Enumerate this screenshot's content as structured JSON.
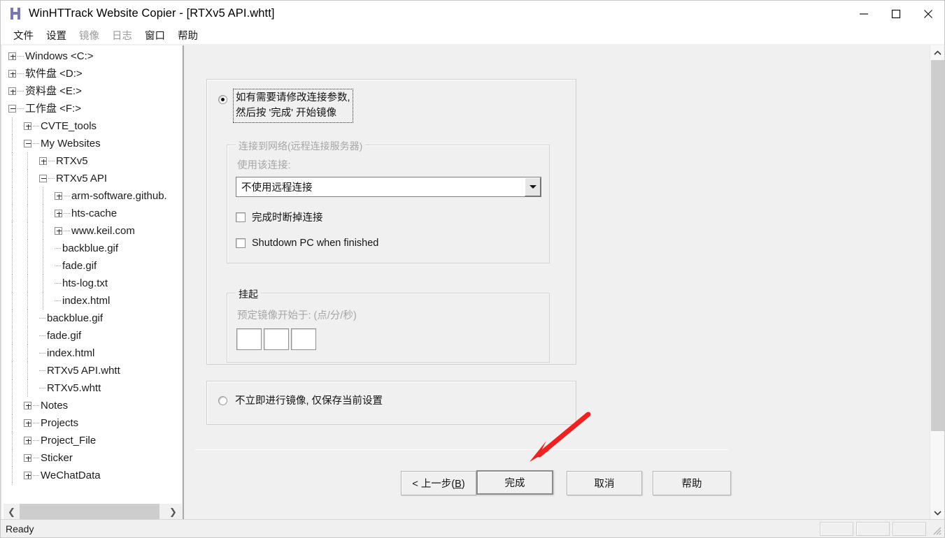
{
  "window": {
    "title": "WinHTTrack Website Copier - [RTXv5 API.whtt]",
    "logo_icon": "winhttrack-h-logo-icon",
    "controls": {
      "minimize": "minimize-icon",
      "maximize": "maximize-icon",
      "close": "close-icon"
    }
  },
  "menubar": {
    "items": [
      {
        "label": "文件",
        "disabled": false
      },
      {
        "label": "设置",
        "disabled": false
      },
      {
        "label": "镜像",
        "disabled": true
      },
      {
        "label": "日志",
        "disabled": true
      },
      {
        "label": "窗口",
        "disabled": false
      },
      {
        "label": "帮助",
        "disabled": false
      }
    ]
  },
  "tree": {
    "nodes": [
      {
        "label": "Windows <C:>",
        "depth": 0,
        "toggle": "plus"
      },
      {
        "label": "软件盘 <D:>",
        "depth": 0,
        "toggle": "plus"
      },
      {
        "label": "资料盘 <E:>",
        "depth": 0,
        "toggle": "plus"
      },
      {
        "label": "工作盘 <F:>",
        "depth": 0,
        "toggle": "minus"
      },
      {
        "label": "CVTE_tools",
        "depth": 1,
        "toggle": "plus"
      },
      {
        "label": "My Websites",
        "depth": 1,
        "toggle": "minus"
      },
      {
        "label": "RTXv5",
        "depth": 2,
        "toggle": "plus"
      },
      {
        "label": "RTXv5 API",
        "depth": 2,
        "toggle": "minus"
      },
      {
        "label": "arm-software.github.",
        "depth": 3,
        "toggle": "plus"
      },
      {
        "label": "hts-cache",
        "depth": 3,
        "toggle": "plus"
      },
      {
        "label": "www.keil.com",
        "depth": 3,
        "toggle": "plus"
      },
      {
        "label": "backblue.gif",
        "depth": 3,
        "toggle": "leaf"
      },
      {
        "label": "fade.gif",
        "depth": 3,
        "toggle": "leaf"
      },
      {
        "label": "hts-log.txt",
        "depth": 3,
        "toggle": "leaf"
      },
      {
        "label": "index.html",
        "depth": 3,
        "toggle": "leaf"
      },
      {
        "label": "backblue.gif",
        "depth": 2,
        "toggle": "leaf"
      },
      {
        "label": "fade.gif",
        "depth": 2,
        "toggle": "leaf"
      },
      {
        "label": "index.html",
        "depth": 2,
        "toggle": "leaf"
      },
      {
        "label": "RTXv5 API.whtt",
        "depth": 2,
        "toggle": "leaf"
      },
      {
        "label": "RTXv5.whtt",
        "depth": 2,
        "toggle": "leaf"
      },
      {
        "label": "Notes",
        "depth": 1,
        "toggle": "plus"
      },
      {
        "label": "Projects",
        "depth": 1,
        "toggle": "plus"
      },
      {
        "label": "Project_File",
        "depth": 1,
        "toggle": "plus"
      },
      {
        "label": "Sticker",
        "depth": 1,
        "toggle": "plus"
      },
      {
        "label": "WeChatData",
        "depth": 1,
        "toggle": "plus"
      }
    ],
    "hscroll": {
      "left_arrow": "chevron-left-icon",
      "right_arrow": "chevron-right-icon"
    }
  },
  "main": {
    "option_mirror": {
      "radio_checked": true,
      "label": "如有需要请修改连接参数,\n然后按 '完成' 开始镜像"
    },
    "network_group": {
      "title": "连接到网络(远程连接服务器)",
      "disabled": true,
      "connection_label": "使用该连接:",
      "connection_value": "不使用远程连接",
      "dropdown_icon": "chevron-down-icon",
      "checkboxes": [
        {
          "label": "完成时断掉连接",
          "checked": false
        },
        {
          "label": "Shutdown PC when finished",
          "checked": false
        }
      ]
    },
    "suspend_group": {
      "title": "挂起",
      "schedule_label": "预定镜像开始于: (点/分/秒)",
      "fields": [
        "",
        "",
        ""
      ]
    },
    "option_save_only": {
      "radio_checked": false,
      "label": "不立即进行镜像, 仅保存当前设置"
    },
    "buttons": [
      {
        "name": "back",
        "label_pre": "< 上一步(",
        "label_key": "B",
        "label_post": ")",
        "default": false
      },
      {
        "name": "finish",
        "label": "完成",
        "default": true
      },
      {
        "name": "cancel",
        "label": "取消",
        "default": false
      },
      {
        "name": "help",
        "label": "帮助",
        "default": false
      }
    ],
    "annotation": {
      "type": "red-arrow",
      "color": "#ee2222",
      "points_to": "finish-button"
    }
  },
  "statusbar": {
    "text": "Ready",
    "panels": [
      "",
      "",
      ""
    ],
    "grip_icon": "resize-grip-icon"
  },
  "colors": {
    "window_bg": "#f0f0f0",
    "panel_bg": "#ffffff",
    "text": "#121212",
    "disabled_text": "#a6a6a6",
    "accent_logo": "#7b76b5",
    "scroll_thumb": "#cdcdcd",
    "annotation": "#ee2222"
  },
  "scrollbars": {
    "vertical": {
      "up_icon": "chevron-up-icon",
      "down_icon": "chevron-down-icon"
    }
  }
}
